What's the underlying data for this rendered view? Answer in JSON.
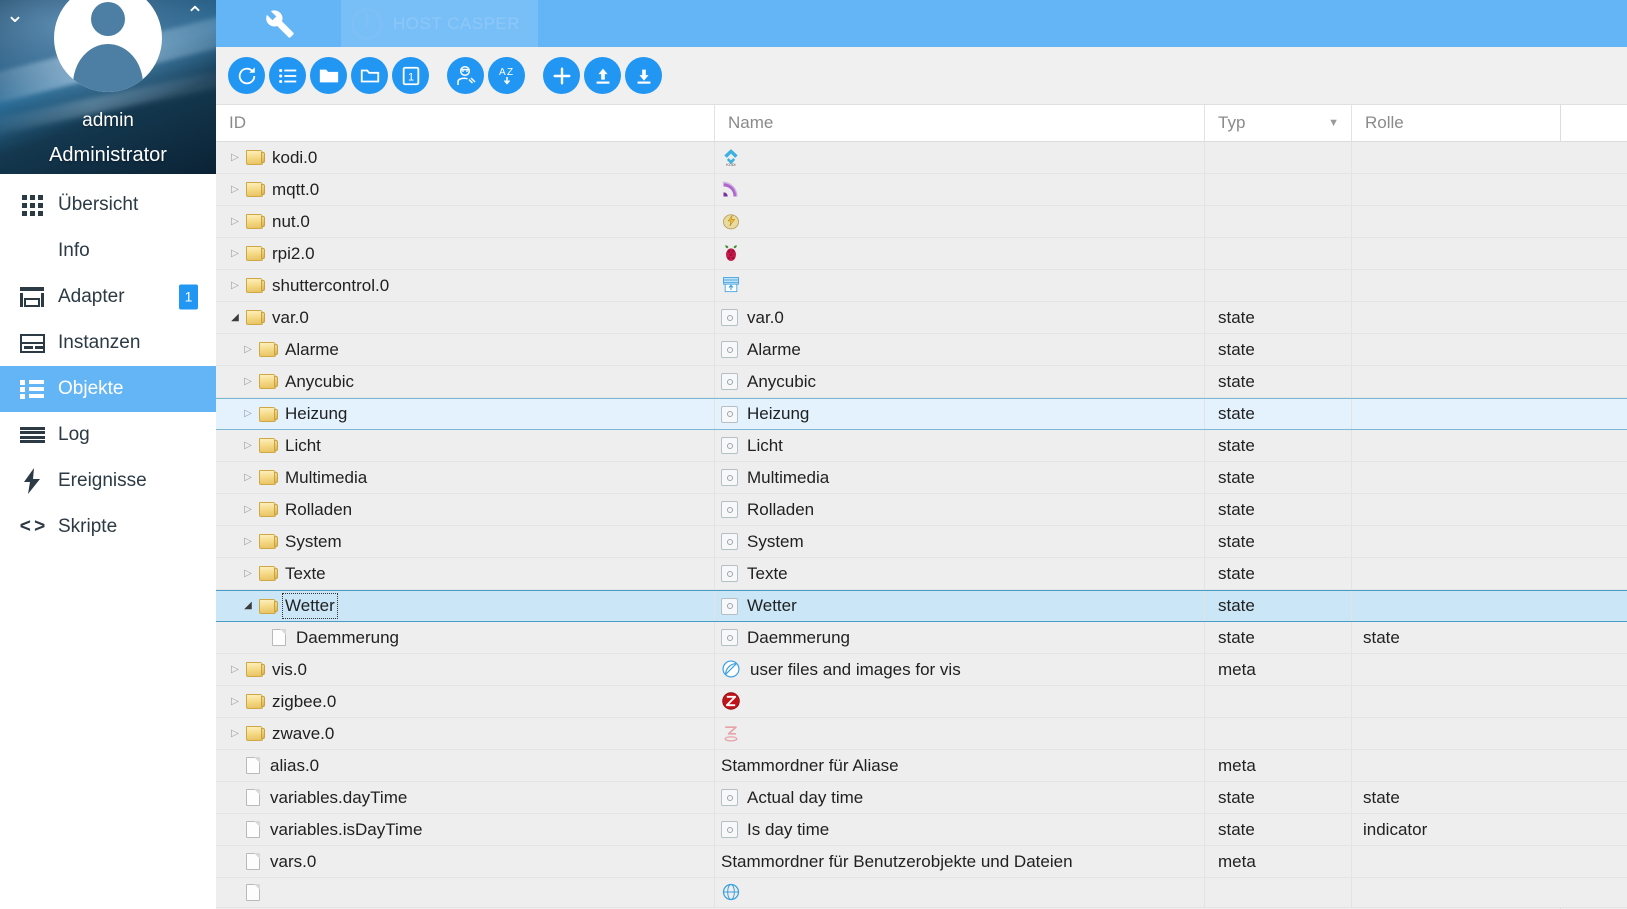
{
  "sidebar": {
    "chev_down": "⌄",
    "chev_up": "⌃",
    "username": "admin",
    "role": "Administrator",
    "items": [
      {
        "label": "Übersicht",
        "icon": "grid-icon",
        "name": "sidebar-item-uebersicht",
        "badge": ""
      },
      {
        "label": "Info",
        "icon": "info-icon",
        "name": "sidebar-item-info",
        "badge": ""
      },
      {
        "label": "Adapter",
        "icon": "shop-icon",
        "name": "sidebar-item-adapter",
        "badge": "1"
      },
      {
        "label": "Instanzen",
        "icon": "instances-icon",
        "name": "sidebar-item-instanzen",
        "badge": ""
      },
      {
        "label": "Objekte",
        "icon": "objects-icon",
        "name": "sidebar-item-objekte",
        "badge": ""
      },
      {
        "label": "Log",
        "icon": "log-icon",
        "name": "sidebar-item-log",
        "badge": ""
      },
      {
        "label": "Ereignisse",
        "icon": "bolt-icon",
        "name": "sidebar-item-ereignisse",
        "badge": ""
      },
      {
        "label": "Skripte",
        "icon": "code-icon",
        "name": "sidebar-item-skripte",
        "badge": ""
      }
    ],
    "active_index": 4
  },
  "topbar": {
    "settings_icon": "wrench-icon",
    "host_label": "HOST CASPER",
    "host_power_icon": "power-icon"
  },
  "toolbar": {
    "buttons": [
      {
        "name": "refresh-button",
        "icon": "refresh-icon"
      },
      {
        "name": "list-view-button",
        "icon": "list-icon"
      },
      {
        "name": "expand-all-button",
        "icon": "folder-filled-icon"
      },
      {
        "name": "collapse-all-button",
        "icon": "folder-outline-icon"
      },
      {
        "name": "expand-one-level-button",
        "icon": "number-one-box-icon"
      },
      {
        "name": "expert-mode-button",
        "icon": "expert-mode-icon"
      },
      {
        "name": "sort-az-button",
        "icon": "sort-az-icon"
      },
      {
        "name": "add-object-button",
        "icon": "plus-icon"
      },
      {
        "name": "import-button",
        "icon": "upload-icon"
      },
      {
        "name": "export-button",
        "icon": "download-icon"
      }
    ]
  },
  "table": {
    "columns": [
      {
        "key": "id",
        "label": "ID",
        "sortable": false
      },
      {
        "key": "name",
        "label": "Name",
        "sortable": false
      },
      {
        "key": "typ",
        "label": "Typ",
        "sortable": true,
        "caret": "▼"
      },
      {
        "key": "rolle",
        "label": "Rolle",
        "sortable": false
      }
    ],
    "rows": [
      {
        "id": "kodi.0",
        "indent": 0,
        "twisty": "closed",
        "icon": "folder",
        "name": "",
        "name_icon": "kodi-adapter-icon",
        "typ": "",
        "rolle": ""
      },
      {
        "id": "mqtt.0",
        "indent": 0,
        "twisty": "closed",
        "icon": "folder",
        "name": "",
        "name_icon": "mqtt-adapter-icon",
        "typ": "",
        "rolle": ""
      },
      {
        "id": "nut.0",
        "indent": 0,
        "twisty": "closed",
        "icon": "folder",
        "name": "",
        "name_icon": "nut-adapter-icon",
        "typ": "",
        "rolle": ""
      },
      {
        "id": "rpi2.0",
        "indent": 0,
        "twisty": "closed",
        "icon": "folder",
        "name": "",
        "name_icon": "raspberry-pi-icon",
        "typ": "",
        "rolle": ""
      },
      {
        "id": "shuttercontrol.0",
        "indent": 0,
        "twisty": "closed",
        "icon": "folder",
        "name": "",
        "name_icon": "shuttercontrol-icon",
        "typ": "",
        "rolle": ""
      },
      {
        "id": "var.0",
        "indent": 0,
        "twisty": "open",
        "icon": "folder",
        "name": "var.0",
        "name_icon": "state-icon",
        "typ": "state",
        "rolle": ""
      },
      {
        "id": "Alarme",
        "indent": 1,
        "twisty": "closed",
        "icon": "folder",
        "name": "Alarme",
        "name_icon": "state-icon",
        "typ": "state",
        "rolle": ""
      },
      {
        "id": "Anycubic",
        "indent": 1,
        "twisty": "closed",
        "icon": "folder",
        "name": "Anycubic",
        "name_icon": "state-icon",
        "typ": "state",
        "rolle": ""
      },
      {
        "id": "Heizung",
        "indent": 1,
        "twisty": "closed",
        "icon": "folder",
        "name": "Heizung",
        "name_icon": "state-icon",
        "typ": "state",
        "rolle": "",
        "state": "hover"
      },
      {
        "id": "Licht",
        "indent": 1,
        "twisty": "closed",
        "icon": "folder",
        "name": "Licht",
        "name_icon": "state-icon",
        "typ": "state",
        "rolle": ""
      },
      {
        "id": "Multimedia",
        "indent": 1,
        "twisty": "closed",
        "icon": "folder",
        "name": "Multimedia",
        "name_icon": "state-icon",
        "typ": "state",
        "rolle": ""
      },
      {
        "id": "Rolladen",
        "indent": 1,
        "twisty": "closed",
        "icon": "folder",
        "name": "Rolladen",
        "name_icon": "state-icon",
        "typ": "state",
        "rolle": ""
      },
      {
        "id": "System",
        "indent": 1,
        "twisty": "closed",
        "icon": "folder",
        "name": "System",
        "name_icon": "state-icon",
        "typ": "state",
        "rolle": ""
      },
      {
        "id": "Texte",
        "indent": 1,
        "twisty": "closed",
        "icon": "folder",
        "name": "Texte",
        "name_icon": "state-icon",
        "typ": "state",
        "rolle": ""
      },
      {
        "id": "Wetter",
        "indent": 1,
        "twisty": "open",
        "icon": "folder",
        "name": "Wetter",
        "name_icon": "state-icon",
        "typ": "state",
        "rolle": "",
        "state": "selected",
        "focused": true
      },
      {
        "id": "Daemmerung",
        "indent": 2,
        "twisty": "none",
        "icon": "doc",
        "name": "Daemmerung",
        "name_icon": "state-icon",
        "typ": "state",
        "rolle": "state"
      },
      {
        "id": "vis.0",
        "indent": 0,
        "twisty": "closed",
        "icon": "folder",
        "name": "user files and images for vis",
        "name_icon": "vis-adapter-icon",
        "typ": "meta",
        "rolle": ""
      },
      {
        "id": "zigbee.0",
        "indent": 0,
        "twisty": "closed",
        "icon": "folder",
        "name": "",
        "name_icon": "zigbee-adapter-icon",
        "typ": "",
        "rolle": ""
      },
      {
        "id": "zwave.0",
        "indent": 0,
        "twisty": "closed",
        "icon": "folder",
        "name": "",
        "name_icon": "zwave-adapter-icon",
        "typ": "",
        "rolle": ""
      },
      {
        "id": "alias.0",
        "indent": 0,
        "twisty": "none",
        "icon": "doc",
        "name": "Stammordner für Aliase",
        "name_icon": "",
        "typ": "meta",
        "rolle": ""
      },
      {
        "id": "variables.dayTime",
        "indent": 0,
        "twisty": "none",
        "icon": "doc",
        "name": "Actual day time",
        "name_icon": "state-icon",
        "typ": "state",
        "rolle": "state"
      },
      {
        "id": "variables.isDayTime",
        "indent": 0,
        "twisty": "none",
        "icon": "doc",
        "name": "Is day time",
        "name_icon": "state-icon",
        "typ": "state",
        "rolle": "indicator"
      },
      {
        "id": "vars.0",
        "indent": 0,
        "twisty": "none",
        "icon": "doc",
        "name": "Stammordner für Benutzerobjekte und Dateien",
        "name_icon": "",
        "typ": "meta",
        "rolle": ""
      },
      {
        "id": "",
        "indent": 0,
        "twisty": "none",
        "icon": "doc",
        "name": "",
        "name_icon": "web-adapter-icon",
        "typ": "",
        "rolle": "",
        "partial": true
      }
    ]
  },
  "colors": {
    "accent": "#2196f3",
    "header_blue": "#64b5f6",
    "selected_row": "#cbe7f7",
    "hover_row": "#e3f2fd",
    "row_bg": "#eeeeee"
  }
}
